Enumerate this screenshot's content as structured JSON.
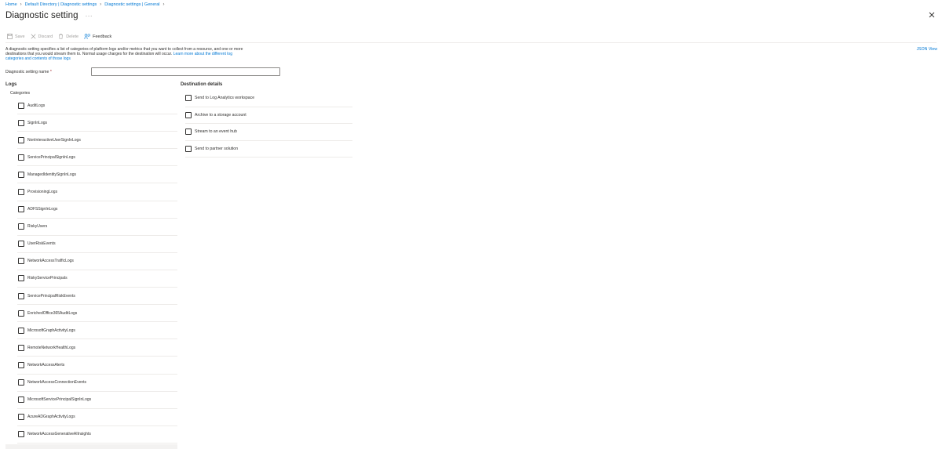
{
  "breadcrumb": [
    "Home",
    "Default Directory | Diagnostic settings",
    "Diagnostic settings | General"
  ],
  "title": "Diagnostic setting",
  "more_glyph": "···",
  "toolbar": {
    "save": "Save",
    "discard": "Discard",
    "delete": "Delete",
    "feedback": "Feedback"
  },
  "description": {
    "text": "A diagnostic setting specifies a list of categories of platform logs and/or metrics that you want to collect from a resource, and one or more destinations that you would stream them to. Normal usage charges for the destination will occur.",
    "link": "Learn more about the different log categories and contents of those logs"
  },
  "json_view": "JSON View",
  "name_field": {
    "label": "Diagnostic setting name",
    "required_mark": "*",
    "value": ""
  },
  "logs": {
    "heading": "Logs",
    "categories_label": "Categories",
    "categories": [
      "AuditLogs",
      "SignInLogs",
      "NonInteractiveUserSignInLogs",
      "ServicePrincipalSignInLogs",
      "ManagedIdentitySignInLogs",
      "ProvisioningLogs",
      "ADFSSignInLogs",
      "RiskyUsers",
      "UserRiskEvents",
      "NetworkAccessTrafficLogs",
      "RiskyServicePrincipals",
      "ServicePrincipalRiskEvents",
      "EnrichedOffice365AuditLogs",
      "MicrosoftGraphActivityLogs",
      "RemoteNetworkHealthLogs",
      "NetworkAccessAlerts",
      "NetworkAccessConnectionEvents",
      "MicrosoftServicePrincipalSignInLogs",
      "AzureADGraphActivityLogs",
      "NetworkAccessGenerativeAIInsights"
    ]
  },
  "destination": {
    "heading": "Destination details",
    "options": [
      "Send to Log Analytics workspace",
      "Archive to a storage account",
      "Stream to an event hub",
      "Send to partner solution"
    ]
  },
  "colors": {
    "link": "#0078d4",
    "text": "#323130",
    "disabled": "#a19f9d",
    "divider": "#edebe9",
    "required": "#a4262c"
  }
}
